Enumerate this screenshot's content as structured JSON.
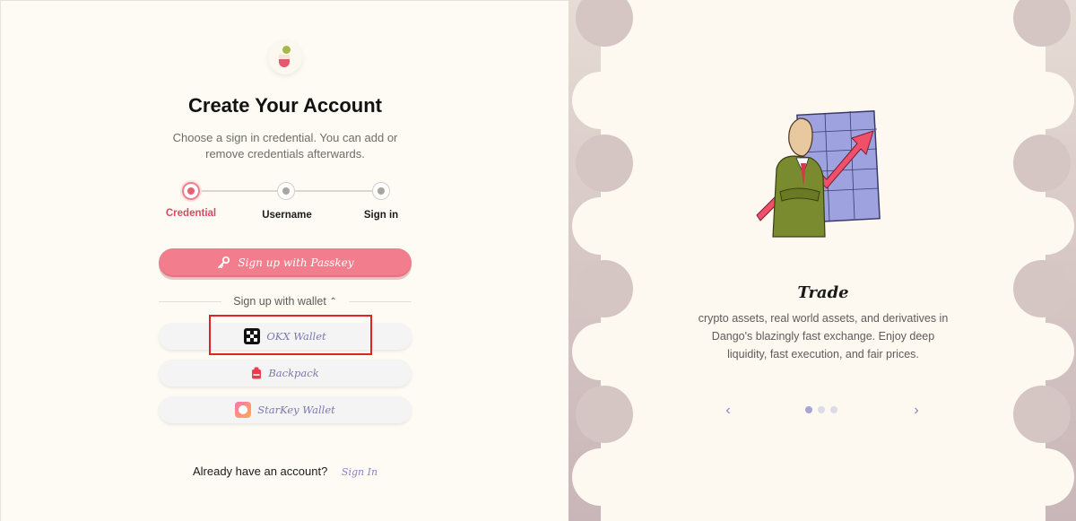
{
  "auth": {
    "title": "Create Your Account",
    "subtitle": "Choose a sign in credential. You can add or remove credentials afterwards.",
    "steps": [
      {
        "label": "Credential",
        "active": true
      },
      {
        "label": "Username",
        "active": false
      },
      {
        "label": "Sign in",
        "active": false
      }
    ],
    "passkey_button": "Sign up with Passkey",
    "wallet_toggle": "Sign up with wallet",
    "wallets": [
      {
        "label": "OKX Wallet",
        "icon": "okx-icon"
      },
      {
        "label": "Backpack",
        "icon": "backpack-icon"
      },
      {
        "label": "StarKey Wallet",
        "icon": "starkey-icon"
      }
    ],
    "have_account": "Already have an account?",
    "signin_link": "Sign In"
  },
  "carousel": {
    "title": "Trade",
    "text": "crypto assets, real world assets, and derivatives in Dango's blazingly fast exchange. Enjoy deep liquidity, fast execution, and fair prices.",
    "current_slide": 1,
    "total_slides": 3,
    "prev_icon": "chevron-left-icon",
    "next_icon": "chevron-right-icon"
  },
  "colors": {
    "accent_pink": "#f27d8c",
    "link_purple": "#8a82c2",
    "highlight_red": "#e02424"
  }
}
